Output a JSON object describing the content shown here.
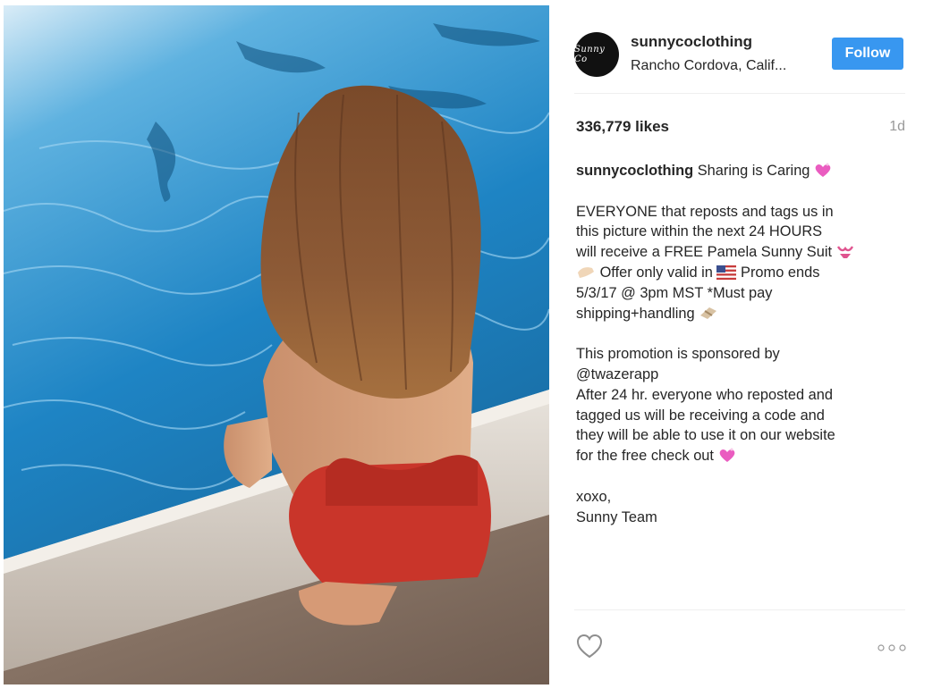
{
  "post": {
    "username": "sunnycoclothing",
    "location": "Rancho Cordova, Calif...",
    "avatar_text": "Sunny Co",
    "follow_label": "Follow",
    "likes": "336,779 likes",
    "time": "1d",
    "caption": {
      "user": "sunnycoclothing",
      "line1": "Sharing is Caring",
      "lines": [
        "EVERYONE that reposts and tags us in",
        "this picture within the next 24 HOURS",
        "will receive a FREE Pamela Sunny Suit",
        "Offer only valid in",
        "Promo ends",
        "5/3/17 @ 3pm MST *Must pay",
        "shipping+handling"
      ],
      "sponsor_line": "This promotion is sponsored by",
      "mention": "@twazerapp",
      "after_lines": [
        "After 24 hr. everyone who reposted and",
        "tagged us will be receiving a code and",
        "they will be able to use it on our website",
        "for the free check out"
      ],
      "signoff1": "xoxo,",
      "signoff2": "Sunny Team"
    }
  },
  "icons": {
    "heart": "heart-outline-icon",
    "more": "more-options-icon",
    "sparkle_heart": "sparkling-heart-emoji",
    "bikini": "bikini-emoji",
    "hand": "raised-hand-emoji",
    "flag": "us-flag-emoji",
    "package": "package-emoji"
  },
  "colors": {
    "follow_bg": "#3897f0",
    "pool": "#1e7fbf",
    "swimsuit": "#c9352a"
  }
}
